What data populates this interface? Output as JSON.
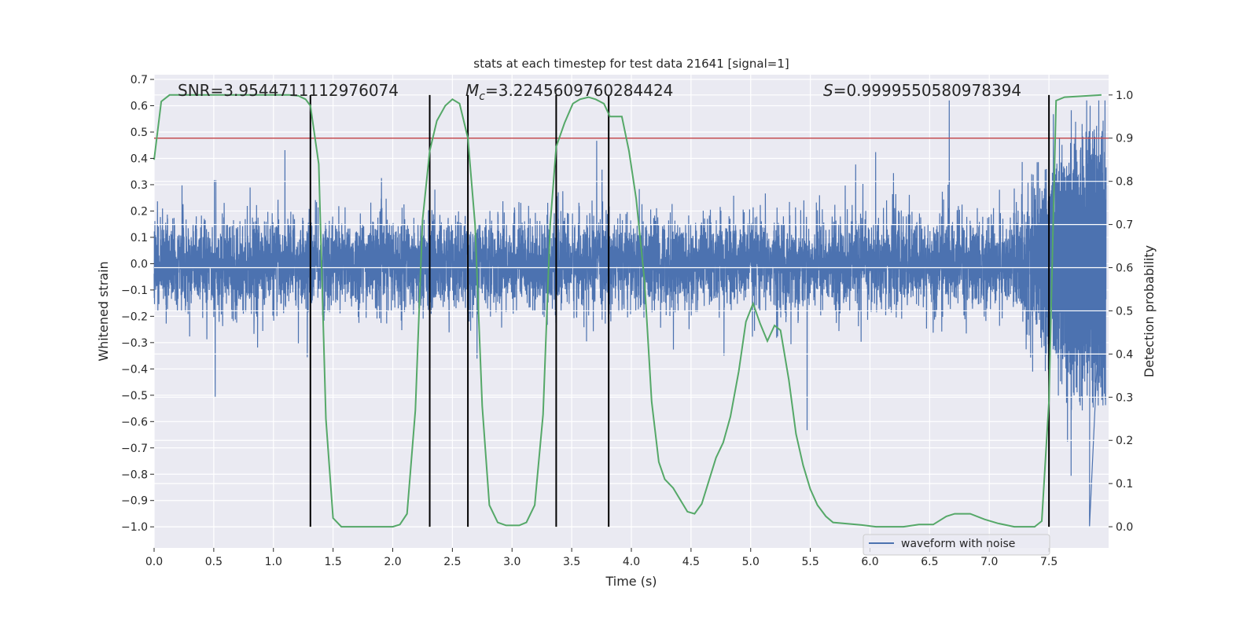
{
  "chart_data": {
    "type": "line",
    "title": "stats at each timestep for test data 21641 [signal=1]",
    "xlabel": "Time (s)",
    "ylabel": "Whitened strain",
    "ylabel_right": "Detection probability",
    "xlim": [
      0.0,
      8.0
    ],
    "ylim": [
      -1.08,
      0.718
    ],
    "ylim_right": [
      -0.049,
      1.047
    ],
    "xticks": [
      "0.0",
      "0.5",
      "1.0",
      "1.5",
      "2.0",
      "2.5",
      "3.0",
      "3.5",
      "4.0",
      "4.5",
      "5.0",
      "5.5",
      "6.0",
      "6.5",
      "7.0",
      "7.5"
    ],
    "yticks": [
      "0.7",
      "0.6",
      "0.5",
      "0.4",
      "0.3",
      "0.2",
      "0.1",
      "0.0",
      "−0.1",
      "−0.2",
      "−0.3",
      "−0.4",
      "−0.5",
      "−0.6",
      "−0.7",
      "−0.8",
      "−0.9",
      "−1.0"
    ],
    "yticks_right": [
      "1.0",
      "0.9",
      "0.8",
      "0.7",
      "0.6",
      "0.5",
      "0.4",
      "0.3",
      "0.2",
      "0.1",
      "0.0"
    ],
    "grid": true,
    "legend": {
      "placement": "lower-right",
      "entries": [
        "waveform with noise"
      ]
    },
    "annotations": {
      "snr": "SNR=3.9544711112976074",
      "mc_symbol": "M",
      "mc_sub": "c",
      "mc_value": "=3.2245609760284424",
      "s_symbol": "S",
      "s_value": "=0.9999550580978394"
    },
    "series": [
      {
        "name": "waveform with noise",
        "axis": "left",
        "color": "#4c72b0",
        "note_visible_range": [
          -1.0,
          0.64
        ]
      },
      {
        "axis": "right",
        "color": "#55a868",
        "t": [
          0.0,
          0.06,
          0.13,
          0.5,
          1.0,
          1.13,
          1.21,
          1.27,
          1.31,
          1.38,
          1.44,
          1.5,
          1.57,
          2.0,
          2.06,
          2.12,
          2.19,
          2.25,
          2.31,
          2.37,
          2.44,
          2.5,
          2.56,
          2.63,
          2.69,
          2.75,
          2.81,
          2.88,
          2.95,
          3.06,
          3.12,
          3.19,
          3.26,
          3.32,
          3.37,
          3.44,
          3.51,
          3.57,
          3.64,
          3.7,
          3.77,
          3.82,
          3.92,
          3.98,
          4.04,
          4.11,
          4.17,
          4.23,
          4.28,
          4.35,
          4.47,
          4.53,
          4.59,
          4.71,
          4.77,
          4.83,
          4.9,
          4.96,
          5.02,
          5.08,
          5.14,
          5.2,
          5.25,
          5.32,
          5.38,
          5.44,
          5.5,
          5.56,
          5.63,
          5.69,
          5.93,
          6.05,
          6.28,
          6.41,
          6.53,
          6.64,
          6.71,
          6.84,
          6.96,
          7.07,
          7.21,
          7.38,
          7.44,
          7.5,
          7.56,
          7.63,
          7.94
        ],
        "p": [
          0.85,
          0.985,
          1.0,
          1.0,
          1.0,
          1.0,
          0.998,
          0.99,
          0.975,
          0.84,
          0.25,
          0.02,
          0.0,
          0.0,
          0.005,
          0.03,
          0.27,
          0.71,
          0.87,
          0.94,
          0.975,
          0.99,
          0.98,
          0.9,
          0.7,
          0.28,
          0.05,
          0.01,
          0.003,
          0.003,
          0.01,
          0.05,
          0.26,
          0.7,
          0.88,
          0.935,
          0.98,
          0.99,
          0.995,
          0.99,
          0.98,
          0.95,
          0.95,
          0.87,
          0.76,
          0.57,
          0.29,
          0.15,
          0.11,
          0.09,
          0.035,
          0.03,
          0.053,
          0.16,
          0.195,
          0.255,
          0.36,
          0.475,
          0.517,
          0.47,
          0.43,
          0.466,
          0.455,
          0.34,
          0.215,
          0.142,
          0.087,
          0.05,
          0.024,
          0.01,
          0.004,
          0.0,
          0.0,
          0.005,
          0.005,
          0.024,
          0.03,
          0.03,
          0.017,
          0.008,
          0.0,
          0.0,
          0.013,
          0.29,
          0.987,
          0.995,
          1.0
        ]
      }
    ],
    "threshold": {
      "axis": "right",
      "value": 0.9,
      "color": "#c44e52"
    },
    "vlines": {
      "axis": "right",
      "x": [
        1.31,
        2.31,
        2.63,
        3.37,
        3.81,
        7.5
      ],
      "ymin": 0.0,
      "ymax": 1.0,
      "color": "#000000"
    },
    "colors": {
      "background": "#eaeaf2",
      "grid": "#ffffff"
    }
  }
}
